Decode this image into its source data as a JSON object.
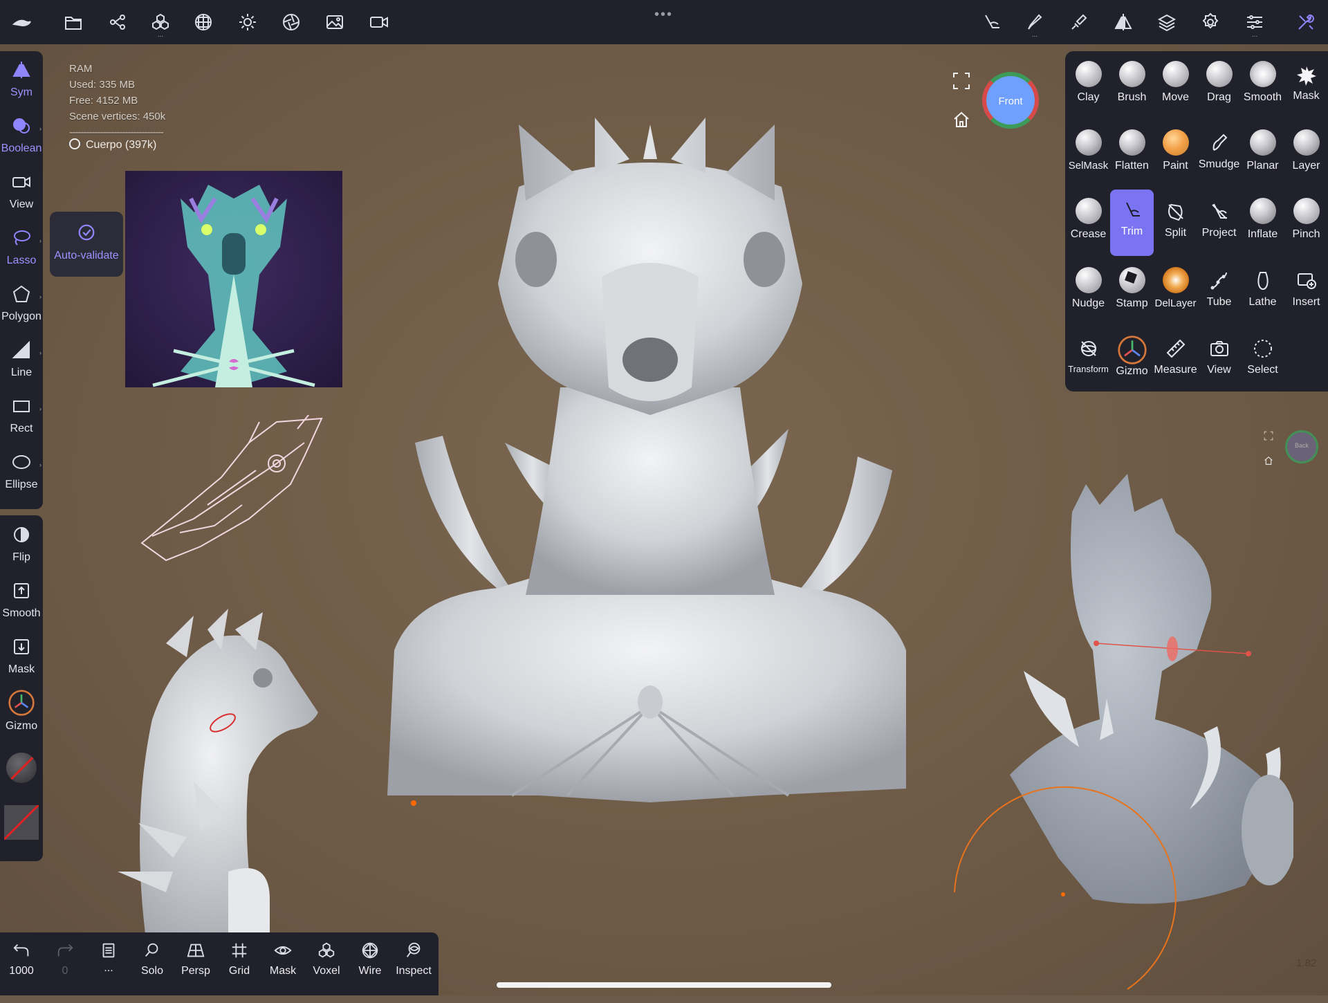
{
  "topbar": {
    "more_dots": "•••",
    "sub_marker": "..."
  },
  "info": {
    "ram_label": "RAM",
    "used": "Used:  335 MB",
    "free": "Free:  4152 MB",
    "vertices": "Scene vertices:  450k",
    "separator": "----------------------------------",
    "mesh": "Cuerpo (397k)"
  },
  "left_tools": [
    {
      "label": "Sym",
      "icon": "symmetry-icon",
      "active": true
    },
    {
      "label": "Boolean",
      "icon": "boolean-icon",
      "active": true
    },
    {
      "label": "View",
      "icon": "camera-icon",
      "active": false
    },
    {
      "label": "Lasso",
      "icon": "lasso-icon",
      "active": true
    },
    {
      "label": "Polygon",
      "icon": "polygon-icon",
      "active": false
    },
    {
      "label": "Line",
      "icon": "line-icon",
      "active": false
    },
    {
      "label": "Rect",
      "icon": "rect-icon",
      "active": false
    },
    {
      "label": "Ellipse",
      "icon": "ellipse-icon",
      "active": false
    },
    {
      "label": "Flip",
      "icon": "flip-icon",
      "active": false
    },
    {
      "label": "Smooth",
      "icon": "smooth-icon",
      "active": false
    },
    {
      "label": "Mask",
      "icon": "mask-icon",
      "active": false
    },
    {
      "label": "Gizmo",
      "icon": "gizmo-icon",
      "active": false
    }
  ],
  "auto_validate": {
    "label": "Auto-validate"
  },
  "tools": [
    {
      "label": "Clay"
    },
    {
      "label": "Brush"
    },
    {
      "label": "Move"
    },
    {
      "label": "Drag"
    },
    {
      "label": "Smooth"
    },
    {
      "label": "Mask"
    },
    {
      "label": "SelMask"
    },
    {
      "label": "Flatten"
    },
    {
      "label": "Paint"
    },
    {
      "label": "Smudge"
    },
    {
      "label": "Planar"
    },
    {
      "label": "Layer"
    },
    {
      "label": "Crease"
    },
    {
      "label": "Trim"
    },
    {
      "label": "Split"
    },
    {
      "label": "Project"
    },
    {
      "label": "Inflate"
    },
    {
      "label": "Pinch"
    },
    {
      "label": "Nudge"
    },
    {
      "label": "Stamp"
    },
    {
      "label": "DelLayer"
    },
    {
      "label": "Tube"
    },
    {
      "label": "Lathe"
    },
    {
      "label": "Insert"
    },
    {
      "label": "Transform"
    },
    {
      "label": "Gizmo"
    },
    {
      "label": "Measure"
    },
    {
      "label": "View"
    },
    {
      "label": "Select"
    }
  ],
  "view_cube": {
    "label": "Front"
  },
  "view_cube_small": {
    "label": "Back"
  },
  "bottom": {
    "undo": "1000",
    "redo": "0",
    "scenes": "...",
    "solo": "Solo",
    "persp": "Persp",
    "grid": "Grid",
    "mask": "Mask",
    "voxel": "Voxel",
    "wire": "Wire",
    "inspect": "Inspect"
  },
  "zoom": "1.82",
  "colors": {
    "accent": "#8f86ff",
    "panel": "#20212a",
    "background": "#6b5a48"
  }
}
